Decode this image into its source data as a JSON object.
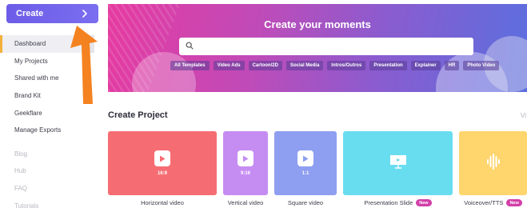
{
  "sidebar": {
    "create_label": "Create",
    "items": [
      {
        "label": "Dashboard",
        "state": "active"
      },
      {
        "label": "My Projects",
        "state": "normal"
      },
      {
        "label": "Shared with me",
        "state": "normal"
      },
      {
        "label": "Brand Kit",
        "state": "normal"
      },
      {
        "label": "Geekflare",
        "state": "normal"
      },
      {
        "label": "Manage Exports",
        "state": "normal"
      },
      {
        "label": "Blog",
        "state": "muted"
      },
      {
        "label": "Hub",
        "state": "muted"
      },
      {
        "label": "FAQ",
        "state": "muted"
      },
      {
        "label": "Tutorials",
        "state": "muted"
      }
    ]
  },
  "hero": {
    "title": "Create your moments",
    "search_placeholder": "",
    "tags": [
      "All Templates",
      "Video Ads",
      "Cartoon/2D",
      "Social Media",
      "Intros/Outros",
      "Presentation",
      "Explainer",
      "HR",
      "Photo Video"
    ]
  },
  "create_project": {
    "title": "Create Project",
    "view_all": "Vi",
    "cards": [
      {
        "label": "Horizontal video",
        "ratio": "16:9",
        "color": "#f56d73",
        "icon": "play-icon",
        "new": false
      },
      {
        "label": "Vertical video",
        "ratio": "9:16",
        "color": "#c58cf2",
        "icon": "play-icon",
        "new": false
      },
      {
        "label": "Square video",
        "ratio": "1:1",
        "color": "#8e9ef0",
        "icon": "play-icon",
        "new": false
      },
      {
        "label": "Presentation Slide",
        "ratio": "",
        "color": "#69ddf0",
        "icon": "presentation-icon",
        "new": true,
        "badge": "New"
      },
      {
        "label": "Voiceover/TTS",
        "ratio": "",
        "color": "#ffd56e",
        "icon": "audio-wave-icon",
        "new": true,
        "badge": "New"
      }
    ]
  },
  "colors": {
    "accent": "#6c5ce7",
    "arrow": "#f58220",
    "active_marker": "#f3b13a",
    "new_badge": "#d23fa8"
  }
}
